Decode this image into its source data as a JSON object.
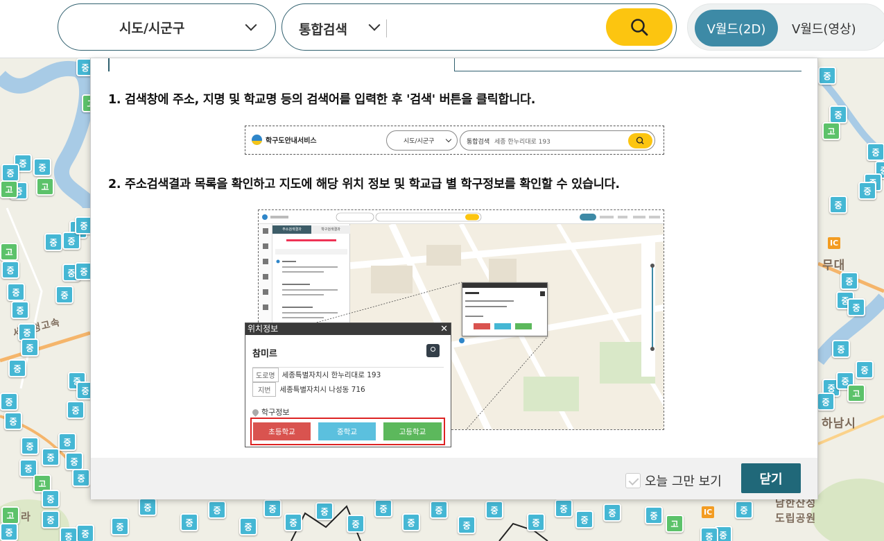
{
  "header": {
    "region_select": "시도/시군구",
    "search_type": "통합검색",
    "search_placeholder": "",
    "view_2d": "V월드(2D)",
    "view_video": "V월드(영상)"
  },
  "map": {
    "labels": [
      "세종청고속",
      "무대",
      "하남시",
      "남한산성",
      "도립공원",
      "라"
    ],
    "ic_label": "IC",
    "marker_middle": "중",
    "marker_high": "고",
    "colors": {
      "middle": "#45b7d4",
      "high": "#5cc26a",
      "ic": "#f39c22"
    }
  },
  "modal": {
    "step1": "1. 검색창에 주소, 지명 및 학교명 등의 검색어를 입력한 후 '검색' 버튼을 클릭합니다.",
    "step2": "2. 주소검색결과 목록을 확인하고 지도에 해당 위치 정보 및 학교급 별 학구정보를 확인할 수 있습니다.",
    "illus1": {
      "logo": "학구도안내서비스",
      "region": "시도/시군구",
      "search_type": "통합검색",
      "search_value": "세종 한누리대로 193"
    },
    "illus2": {
      "tab_a": "주소검색결과",
      "tab_b": "학구검색결과",
      "popup": {
        "title": "위치정보",
        "close": "✕",
        "name": "참미르",
        "road_tag": "도로명",
        "road_addr": "세종특별자치시 한누리대로 193",
        "jibun_tag": "지번",
        "jibun_addr": "세종특별자치시 나성동 716",
        "school_info": "학구정보",
        "btn_elementary": "초등학교",
        "btn_middle": "중학교",
        "btn_high": "고등학교"
      }
    },
    "dont_show_today": "오늘 그만 보기",
    "close_button": "닫기"
  }
}
